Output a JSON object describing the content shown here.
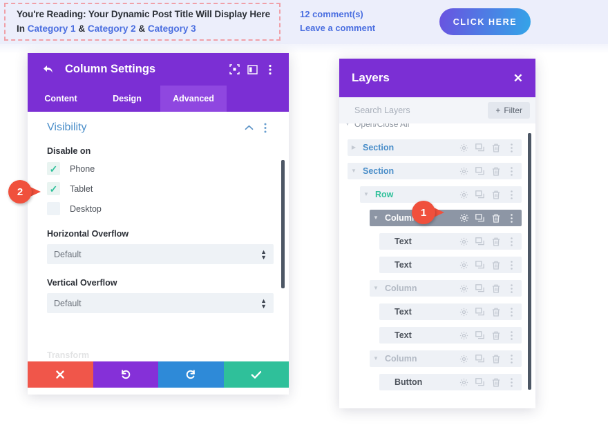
{
  "post_meta": {
    "title_prefix": "You're Reading:",
    "title_text": "Your Dynamic Post Title Will Display Here",
    "title_full": "You're Reading: Your Dynamic Post Title Will Display Here",
    "in_label": "In",
    "categories": [
      "Category 1",
      "Category 2",
      "Category 3"
    ],
    "separator": "&",
    "comments_count": "12 comment(s)",
    "leave_comment": "Leave a comment",
    "cta_label": "CLICK HERE",
    "accent_link": "#4a6ee0",
    "cta_gradient_from": "#6a52e0",
    "cta_gradient_to": "#33a5e8",
    "dashed_border": "#f0a0a8"
  },
  "settings_panel": {
    "title": "Column Settings",
    "back_icon": "back-arrow-icon",
    "header_icons": [
      "expand-icon",
      "layout-view-icon",
      "more-options-icon"
    ],
    "tabs": [
      {
        "label": "Content",
        "active": false
      },
      {
        "label": "Design",
        "active": false
      },
      {
        "label": "Advanced",
        "active": true
      }
    ],
    "section": {
      "title": "Visibility",
      "collapse_icon": "chevron-up-icon",
      "more_icon": "more-options-icon"
    },
    "disable_on": {
      "label": "Disable on",
      "options": [
        {
          "label": "Phone",
          "checked": true
        },
        {
          "label": "Tablet",
          "checked": true
        },
        {
          "label": "Desktop",
          "checked": false
        }
      ]
    },
    "fields": [
      {
        "label": "Horizontal Overflow",
        "value": "Default"
      },
      {
        "label": "Vertical Overflow",
        "value": "Default"
      }
    ],
    "cutoff_text": "Transform",
    "footer_buttons": [
      {
        "name": "cancel-button",
        "icon": "✕",
        "color": "#f0564a"
      },
      {
        "name": "undo-button",
        "icon": "↺",
        "color": "#8530d8"
      },
      {
        "name": "redo-button",
        "icon": "↻",
        "color": "#2e8ad8"
      },
      {
        "name": "save-button",
        "icon": "✔",
        "color": "#2fc09a"
      }
    ],
    "header_color": "#7b2fd4",
    "tab_active_color": "#8f47e0"
  },
  "layers_panel": {
    "title": "Layers",
    "close_icon": "close-icon",
    "search_placeholder": "Search Layers",
    "search_value": "",
    "filter_label": "Filter",
    "filter_icon": "plus-icon",
    "open_close_all": "Open/Close All",
    "row_icons": [
      "gear-icon",
      "duplicate-icon",
      "trash-icon",
      "more-options-icon"
    ],
    "rows": [
      {
        "name": "Section",
        "type": "section",
        "indent": 0,
        "caret": "right",
        "selected": false
      },
      {
        "name": "Section",
        "type": "section",
        "indent": 0,
        "caret": "down",
        "selected": false
      },
      {
        "name": "Row",
        "type": "row",
        "indent": 1,
        "caret": "down",
        "selected": false
      },
      {
        "name": "Column",
        "type": "column",
        "indent": 2,
        "caret": "down",
        "selected": true
      },
      {
        "name": "Text",
        "type": "text",
        "indent": 3,
        "caret": "none",
        "selected": false
      },
      {
        "name": "Text",
        "type": "text",
        "indent": 3,
        "caret": "none",
        "selected": false
      },
      {
        "name": "Column",
        "type": "column",
        "indent": 2,
        "caret": "down",
        "selected": false
      },
      {
        "name": "Text",
        "type": "text",
        "indent": 3,
        "caret": "none",
        "selected": false
      },
      {
        "name": "Text",
        "type": "text",
        "indent": 3,
        "caret": "none",
        "selected": false
      },
      {
        "name": "Column",
        "type": "column",
        "indent": 2,
        "caret": "down",
        "selected": false
      },
      {
        "name": "Button",
        "type": "button",
        "indent": 3,
        "caret": "none",
        "selected": false
      }
    ],
    "header_color": "#7b2fd4",
    "selected_row_color": "#8d96a5"
  },
  "markers": [
    {
      "number": "1",
      "target": "column-row-gear-icon",
      "color": "#f0503c"
    },
    {
      "number": "2",
      "target": "disable-on-checkboxes",
      "color": "#f0503c"
    }
  ]
}
